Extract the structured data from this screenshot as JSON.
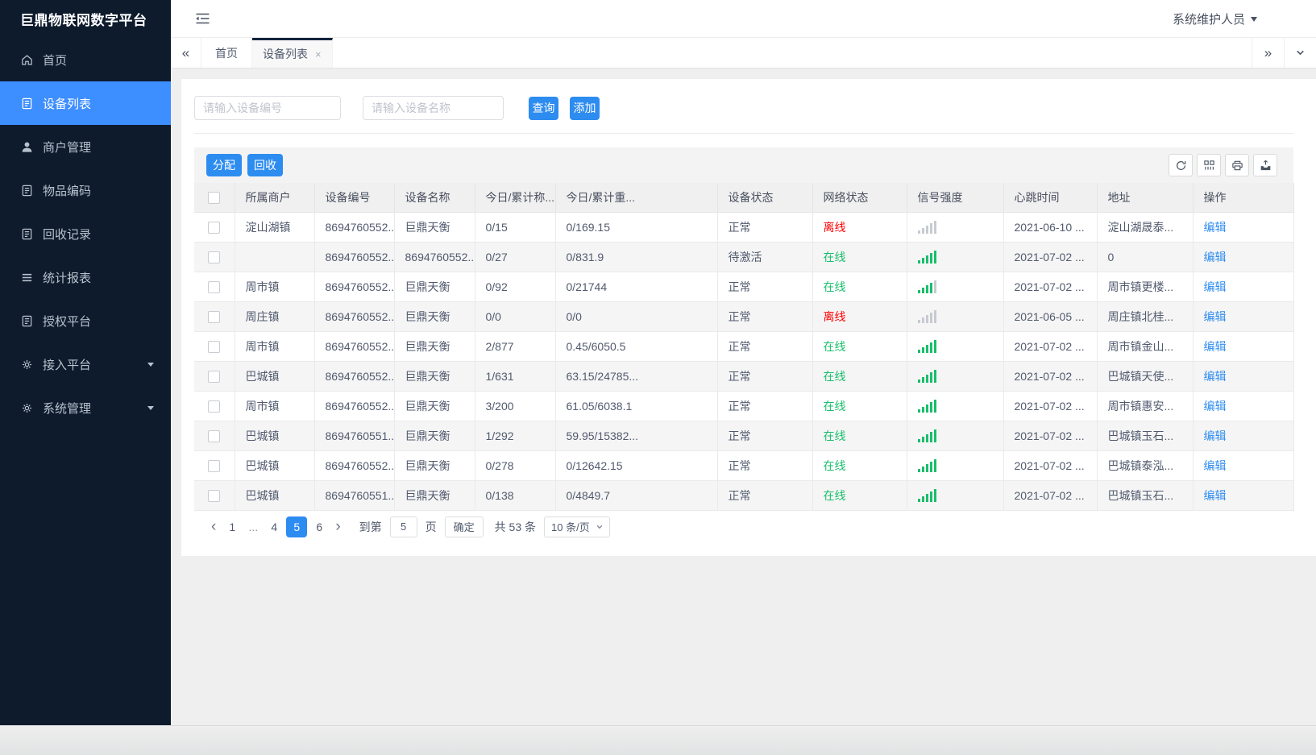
{
  "app": {
    "title": "巨鼎物联网数字平台",
    "user": "系统维护人员"
  },
  "sidebar": {
    "items": [
      {
        "id": "home",
        "label": "首页",
        "icon": "home-icon"
      },
      {
        "id": "device-list",
        "label": "设备列表",
        "icon": "doc-icon",
        "active": true
      },
      {
        "id": "merchant-mgmt",
        "label": "商户管理",
        "icon": "user-icon"
      },
      {
        "id": "item-code",
        "label": "物品编码",
        "icon": "doc-icon"
      },
      {
        "id": "recycle-record",
        "label": "回收记录",
        "icon": "doc-icon"
      },
      {
        "id": "stats-report",
        "label": "统计报表",
        "icon": "list-icon"
      },
      {
        "id": "auth-platform",
        "label": "授权平台",
        "icon": "doc-icon"
      },
      {
        "id": "access-platform",
        "label": "接入平台",
        "icon": "gear-icon",
        "expandable": true
      },
      {
        "id": "system-mgmt",
        "label": "系统管理",
        "icon": "gear-icon",
        "expandable": true
      }
    ]
  },
  "tabs": {
    "items": [
      {
        "id": "home",
        "label": "首页"
      },
      {
        "id": "device-list",
        "label": "设备列表",
        "active": true,
        "closable": true
      }
    ]
  },
  "search": {
    "device_no_placeholder": "请输入设备编号",
    "device_name_placeholder": "请输入设备名称",
    "query_label": "查询",
    "add_label": "添加"
  },
  "toolbar": {
    "assign_label": "分配",
    "recycle_label": "回收",
    "icons": [
      "refresh-icon",
      "columns-icon",
      "print-icon",
      "export-icon"
    ]
  },
  "table": {
    "columns": [
      "所属商户",
      "设备编号",
      "设备名称",
      "今日/累计称...",
      "今日/累计重...",
      "设备状态",
      "网络状态",
      "信号强度",
      "心跳时间",
      "地址",
      "操作"
    ],
    "edit_label": "编辑",
    "rows": [
      {
        "merchant": "淀山湖镇",
        "device_no": "8694760552...",
        "device_name": "巨鼎天衡",
        "today_count": "0/15",
        "today_weight": "0/169.15",
        "device_status": "正常",
        "network_status": "离线",
        "network_online": false,
        "signal_level": 0,
        "heartbeat": "2021-06-10 ...",
        "address": "淀山湖晟泰..."
      },
      {
        "merchant": "",
        "device_no": "8694760552...",
        "device_name": "8694760552...",
        "today_count": "0/27",
        "today_weight": "0/831.9",
        "device_status": "待激活",
        "network_status": "在线",
        "network_online": true,
        "signal_level": 5,
        "heartbeat": "2021-07-02 ...",
        "address": "0"
      },
      {
        "merchant": "周市镇",
        "device_no": "8694760552...",
        "device_name": "巨鼎天衡",
        "today_count": "0/92",
        "today_weight": "0/21744",
        "device_status": "正常",
        "network_status": "在线",
        "network_online": true,
        "signal_level": 4,
        "heartbeat": "2021-07-02 ...",
        "address": "周市镇更楼..."
      },
      {
        "merchant": "周庄镇",
        "device_no": "8694760552...",
        "device_name": "巨鼎天衡",
        "today_count": "0/0",
        "today_weight": "0/0",
        "device_status": "正常",
        "network_status": "离线",
        "network_online": false,
        "signal_level": 0,
        "heartbeat": "2021-06-05 ...",
        "address": "周庄镇北桂..."
      },
      {
        "merchant": "周市镇",
        "device_no": "8694760552...",
        "device_name": "巨鼎天衡",
        "today_count": "2/877",
        "today_weight": "0.45/6050.5",
        "device_status": "正常",
        "network_status": "在线",
        "network_online": true,
        "signal_level": 5,
        "heartbeat": "2021-07-02 ...",
        "address": "周市镇金山..."
      },
      {
        "merchant": "巴城镇",
        "device_no": "8694760552...",
        "device_name": "巨鼎天衡",
        "today_count": "1/631",
        "today_weight": "63.15/24785...",
        "device_status": "正常",
        "network_status": "在线",
        "network_online": true,
        "signal_level": 5,
        "heartbeat": "2021-07-02 ...",
        "address": "巴城镇天使..."
      },
      {
        "merchant": "周市镇",
        "device_no": "8694760552...",
        "device_name": "巨鼎天衡",
        "today_count": "3/200",
        "today_weight": "61.05/6038.1",
        "device_status": "正常",
        "network_status": "在线",
        "network_online": true,
        "signal_level": 5,
        "heartbeat": "2021-07-02 ...",
        "address": "周市镇惠安..."
      },
      {
        "merchant": "巴城镇",
        "device_no": "8694760551...",
        "device_name": "巨鼎天衡",
        "today_count": "1/292",
        "today_weight": "59.95/15382...",
        "device_status": "正常",
        "network_status": "在线",
        "network_online": true,
        "signal_level": 5,
        "heartbeat": "2021-07-02 ...",
        "address": "巴城镇玉石..."
      },
      {
        "merchant": "巴城镇",
        "device_no": "8694760552...",
        "device_name": "巨鼎天衡",
        "today_count": "0/278",
        "today_weight": "0/12642.15",
        "device_status": "正常",
        "network_status": "在线",
        "network_online": true,
        "signal_level": 5,
        "heartbeat": "2021-07-02 ...",
        "address": "巴城镇泰泓..."
      },
      {
        "merchant": "巴城镇",
        "device_no": "8694760551...",
        "device_name": "巨鼎天衡",
        "today_count": "0/138",
        "today_weight": "0/4849.7",
        "device_status": "正常",
        "network_status": "在线",
        "network_online": true,
        "signal_level": 5,
        "heartbeat": "2021-07-02 ...",
        "address": "巴城镇玉石..."
      }
    ]
  },
  "pagination": {
    "pages": [
      "1",
      "...",
      "4",
      "5",
      "6"
    ],
    "active_page": "5",
    "jump_prefix": "到第",
    "jump_value": "5",
    "jump_suffix": "页",
    "confirm_label": "确定",
    "total_text": "共 53 条",
    "page_size_text": "10 条/页"
  },
  "colors": {
    "primary": "#2d8cf0",
    "sidebar_active": "#3d8eff",
    "sidebar_bg": "#0d1b2d",
    "online": "#19be6b",
    "offline": "#ff0000",
    "link": "#2d8cf0"
  }
}
